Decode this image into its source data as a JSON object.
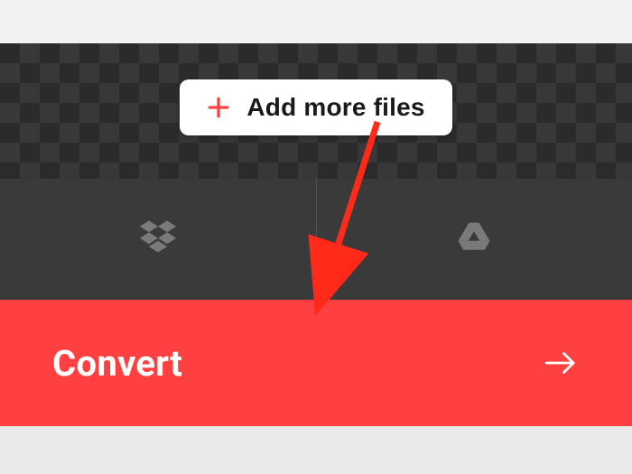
{
  "add_more": {
    "label": "Add more files"
  },
  "cloud": {
    "left_icon": "dropbox-icon",
    "right_icon": "google-drive-icon"
  },
  "convert": {
    "label": "Convert"
  },
  "colors": {
    "accent": "#ff4040",
    "plus": "#ff4040",
    "bg_dark": "#3a3a3a",
    "icon_muted": "#7a7a7a"
  }
}
